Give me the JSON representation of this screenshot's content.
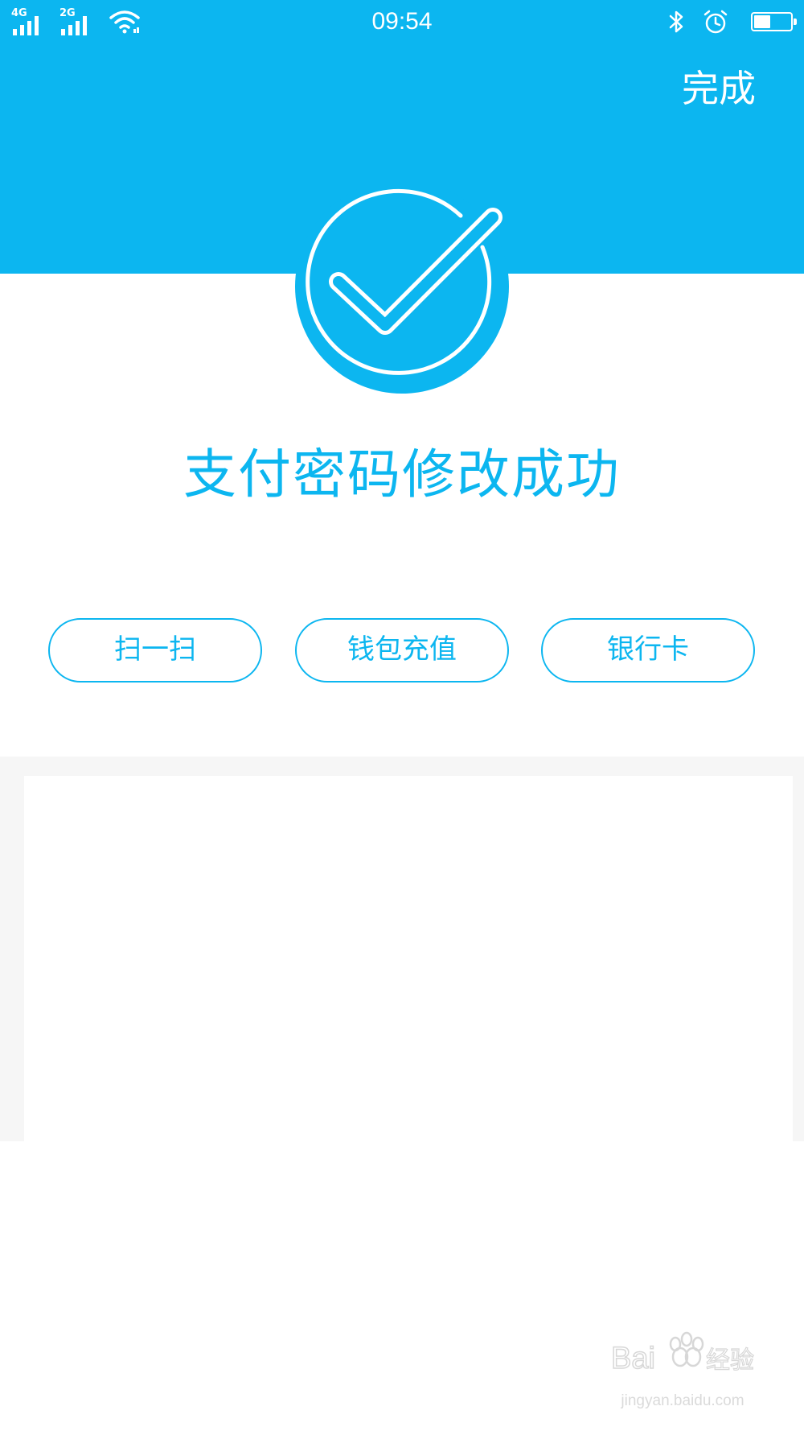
{
  "status_bar": {
    "network_1": "4G",
    "network_2": "2G",
    "time": "09:54",
    "icons": [
      "signal-icon",
      "wifi-icon",
      "bluetooth-icon",
      "alarm-icon",
      "battery-icon"
    ],
    "battery_level": 0.45
  },
  "header": {
    "done_label": "完成",
    "background_color": "#0cb6f0"
  },
  "result": {
    "icon": "checkmark-circle-icon",
    "title": "支付密码修改成功"
  },
  "actions": [
    {
      "label": "扫一扫"
    },
    {
      "label": "钱包充值"
    },
    {
      "label": "银行卡"
    }
  ],
  "watermark": {
    "brand": "Bai du 经验",
    "url": "jingyan.baidu.com"
  },
  "colors": {
    "accent": "#0cb6f0",
    "panel_bg": "#f6f6f6"
  }
}
